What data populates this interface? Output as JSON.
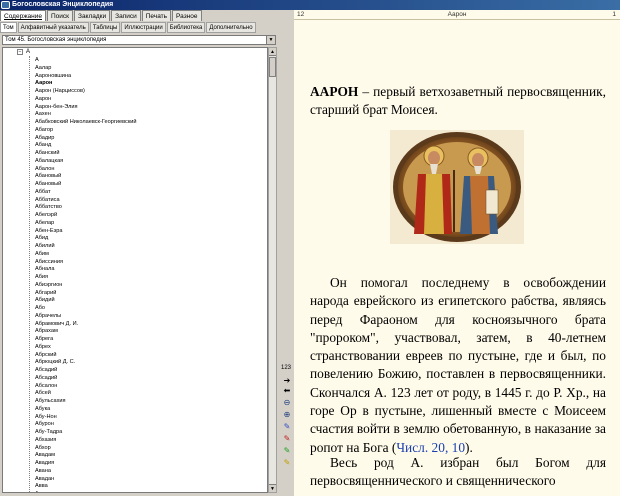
{
  "window": {
    "title": "Богословская Энциклопедия"
  },
  "menu": {
    "items": [
      "Содержание",
      "Поиск",
      "Закладки",
      "Записи",
      "Печать",
      "Разное"
    ]
  },
  "subtabs": {
    "items": [
      "Том",
      "Алфавитный указатель",
      "Таблицы",
      "Иллюстрации",
      "Библиотека",
      "Дополнительно"
    ]
  },
  "volume_select": {
    "value": "Том 45. Богословская энциклопедия"
  },
  "tree": {
    "root_label": "А",
    "items": [
      "А",
      "Аалар",
      "Аароновшина",
      "Аарон",
      "Аарон (Нарциссов)",
      "Аарон",
      "Аарон-бен-Элия",
      "Аахен",
      "Абабковский Николаевск-Георгиевский",
      "Абагор",
      "Абадир",
      "Абанд",
      "Абанский",
      "Абалацкая",
      "Абалон",
      "Абановый",
      "Абановый",
      "Аббат",
      "Аббатиса",
      "Аббатство",
      "Абелэрй",
      "Абелар",
      "Абен-Езра",
      "Абид",
      "Абилий",
      "Абим",
      "Абиссиния",
      "Абнала",
      "Абия",
      "Абиэргион",
      "Абгарий",
      "Абидий",
      "Або",
      "Абрачелы",
      "Абрамович Д. И.",
      "Абрахам",
      "Абрега",
      "Абрех",
      "Абрский",
      "Абрюцкий Д. С.",
      "Абсадий",
      "Абсадий",
      "Абсалон",
      "Абсей",
      "Абульсахия",
      "Абука",
      "Абу-Нон",
      "Абурон",
      "Абу-Тадра",
      "Абхазия",
      "Абхор",
      "Авадам",
      "Авадия",
      "Авана",
      "Авадан",
      "Авва",
      "Авва"
    ],
    "bold_index": 3
  },
  "toolbar": {
    "page_counter": "123"
  },
  "page_header": {
    "left": "12",
    "center": "Аарон",
    "right": "1"
  },
  "article": {
    "headword": "ААРОН",
    "definition": " – первый ветхозаветный первосвященник, старший брат Моисея.",
    "para2": "Он помогал последнему в освобождении народа еврейского из египетского рабства, являясь перед Фараоном для косноязычного брата \"пророком\", участвовал, затем, в 40-летнем странствовании евреев по пустыне, где и был, по повелению Божию, поставлен в первосвященники. Скончался А. 123 лет от роду, в 1445 г. до Р. Хр., на горе Ор в пустыне, лишенный вместе с Моисеем счастия войти в землю обетованную, в наказание за ропот на Бога (",
    "para2_link": "Числ. 20, 10",
    "para2_end": ").",
    "para3": "Весь род А. избран был Богом для первосвященнического и священнического"
  },
  "colors": {
    "link": "#1a3fae",
    "page_bg": "#fffbea",
    "titlebar": "#0a246a"
  }
}
